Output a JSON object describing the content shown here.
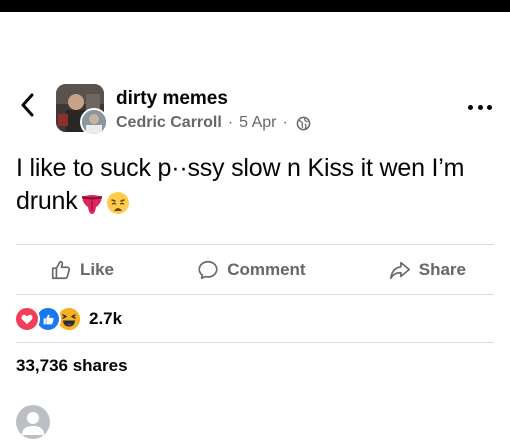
{
  "header": {
    "group_name": "dirty memes",
    "author": "Cedric Carroll",
    "separator": "·",
    "date": "5 Apr",
    "separator2": "·",
    "back_icon": "chevron-left-icon",
    "privacy_icon": "globe-icon",
    "more_icon": "more-dots-icon"
  },
  "post": {
    "text": "I like to suck p··ssy slow n Kiss it wen I’m drunk",
    "emojis": [
      "tongue-emoji",
      "weary-face-emoji"
    ]
  },
  "actions": {
    "like_label": "Like",
    "comment_label": "Comment",
    "share_label": "Share"
  },
  "stats": {
    "reaction_icons": [
      "love-reaction",
      "like-reaction",
      "haha-reaction"
    ],
    "reaction_count": "2.7k",
    "shares": "33,736 shares"
  },
  "colors": {
    "text_primary": "#050505",
    "text_secondary": "#65676b",
    "divider": "#dadde1",
    "like_blue": "#1877f2",
    "love_red": "#f33e58",
    "haha_yellow": "#f7b125"
  }
}
